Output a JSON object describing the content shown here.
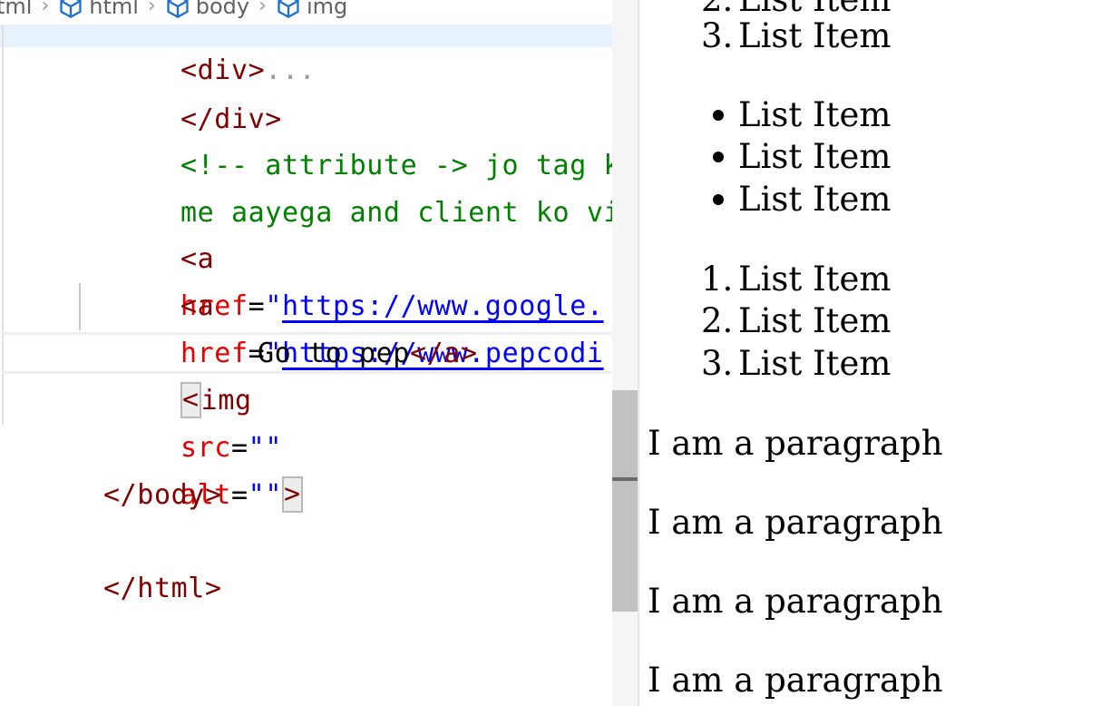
{
  "editor": {
    "breadcrumb": {
      "items": [
        "tml",
        "html",
        "body",
        "img"
      ]
    },
    "lines": {
      "l0": "<div>",
      "l0_fold": "...",
      "l1": "</div>",
      "l2": "<!-- attribute -> jo tag ki ",
      "l3": "me aayega and client ko visi",
      "l4_tag": "<a",
      "l4_attr": "href",
      "l4_eq": "=",
      "l4_quote": "\"",
      "l4_url": "https://www.google.",
      "l5_tag": "<a",
      "l5_attr": "href",
      "l5_eq": "=",
      "l5_quote": "\"",
      "l5_url": "https://www.pepcodi",
      "l6_text": "Go to pep",
      "l6_close": "</a>",
      "l7_open": "<",
      "l7_tag": "img",
      "l7_attr1": "src",
      "l7_eq1": "=",
      "l7_val1": "\"\"",
      "l7_attr2": "alt",
      "l7_eq2": "=",
      "l7_val2": "\"\"",
      "l7_close": ">",
      "l8": "</body>",
      "l9": "</html>"
    }
  },
  "preview": {
    "ol_top": [
      {
        "num": "2.",
        "label": "List Item"
      },
      {
        "num": "3.",
        "label": "List Item"
      }
    ],
    "ul": [
      "List Item",
      "List Item",
      "List Item"
    ],
    "ol": [
      {
        "num": "1.",
        "label": "List Item"
      },
      {
        "num": "2.",
        "label": "List Item"
      },
      {
        "num": "3.",
        "label": "List Item"
      }
    ],
    "paragraphs": [
      "I am a paragraph",
      "I am a paragraph",
      "I am a paragraph",
      "I am a paragraph"
    ]
  },
  "colors": {
    "tag": "#800000",
    "attribute": "#e50000",
    "string": "#0000ff",
    "comment": "#008000",
    "line_highlight": "#e8f2ff",
    "scroll_thumb": "#c1c1c1"
  }
}
